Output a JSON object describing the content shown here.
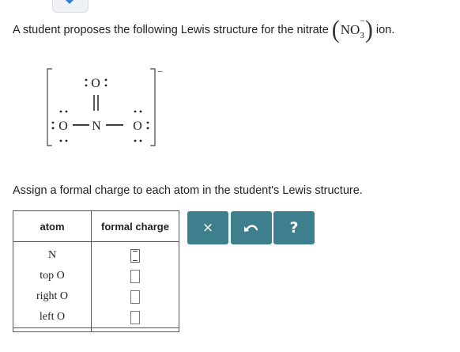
{
  "question": {
    "prefix": "A student proposes the following Lewis structure for the nitrate",
    "formula_main": "NO",
    "formula_sub": "3",
    "formula_sup": "−",
    "suffix": "ion."
  },
  "lewis": {
    "charge": "−",
    "atoms": {
      "top_o": "O",
      "left_o": "O",
      "center_n": "N",
      "right_o": "O"
    }
  },
  "instruction": "Assign a formal charge to each atom in the student's Lewis structure.",
  "table": {
    "headers": {
      "atom": "atom",
      "formal_charge": "formal charge"
    },
    "rows": [
      {
        "atom": "N",
        "value": ""
      },
      {
        "atom": "top O",
        "value": ""
      },
      {
        "atom": "right O",
        "value": ""
      },
      {
        "atom": "left O",
        "value": ""
      }
    ]
  },
  "buttons": {
    "clear": "×",
    "undo": "undo-icon",
    "help": "?"
  },
  "colors": {
    "button_bg": "#3d7f8c",
    "button_fg": "#ffffff"
  }
}
